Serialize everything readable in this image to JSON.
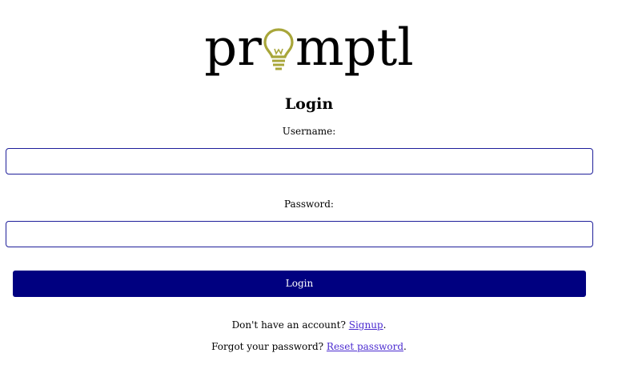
{
  "logo": {
    "text_before": "pr",
    "text_after": "mptl",
    "bulb_color": "#a8a63a",
    "icon": "lightbulb-icon"
  },
  "login": {
    "heading": "Login",
    "username_label": "Username:",
    "username_value": "",
    "password_label": "Password:",
    "password_value": "",
    "button_label": "Login"
  },
  "footer": {
    "signup_prefix": "Don't have an account?",
    "signup_link": "Signup",
    "signup_suffix": ".",
    "reset_prefix": "Forgot your password?",
    "reset_link": "Reset password",
    "reset_suffix": "."
  },
  "colors": {
    "button_bg": "#000080",
    "input_border": "#1f1f9a",
    "link": "#4b2bd0"
  }
}
